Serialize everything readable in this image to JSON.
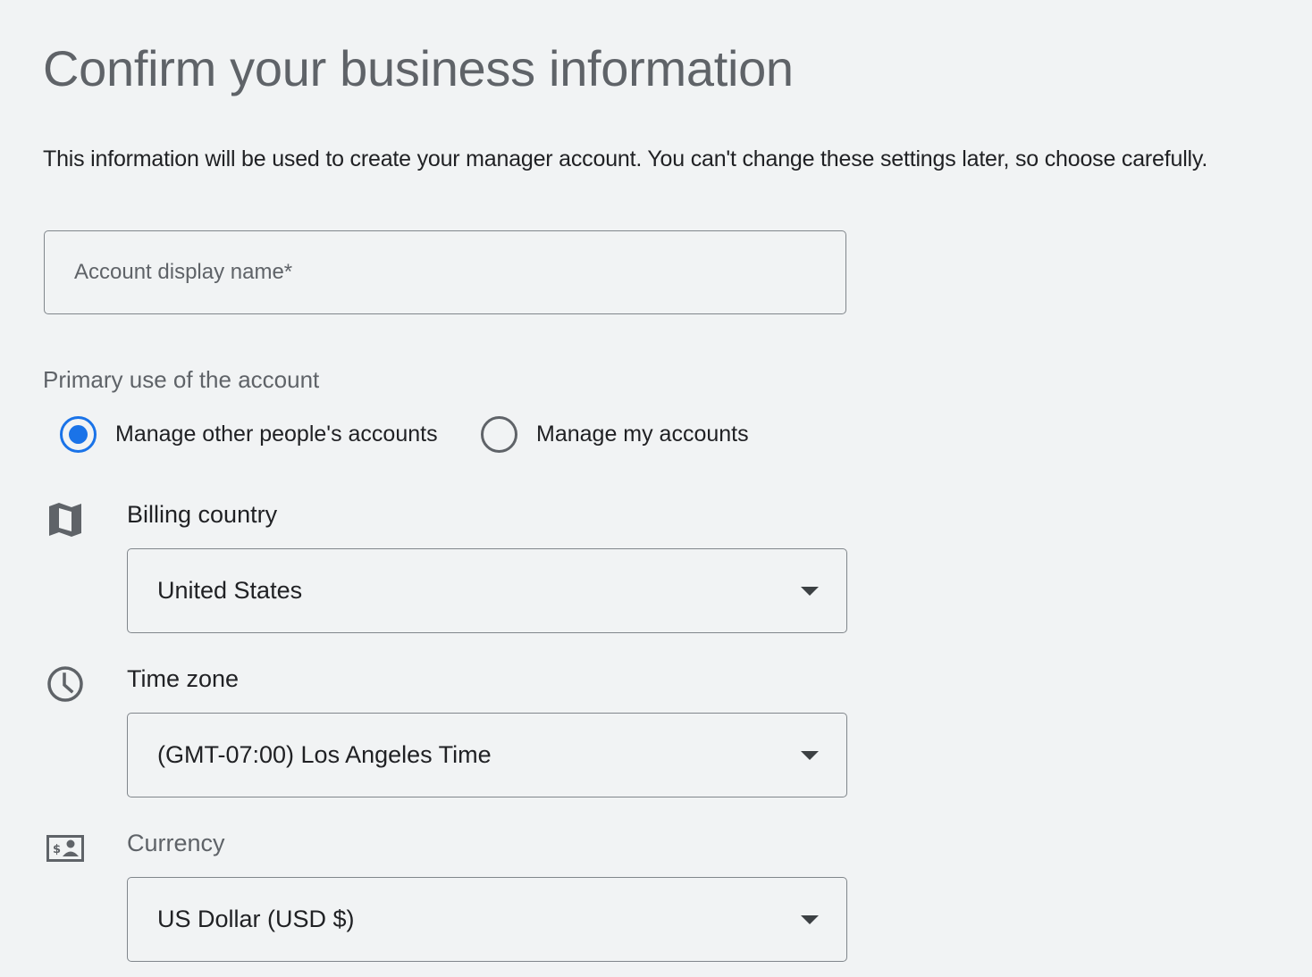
{
  "page": {
    "title": "Confirm your business information",
    "subtitle": "This information will be used to create your manager account. You can't change these settings later, so choose carefully."
  },
  "account_name": {
    "placeholder": "Account display name*",
    "value": ""
  },
  "primary_use": {
    "label": "Primary use of the account",
    "options": [
      {
        "label": "Manage other people's accounts",
        "selected": true
      },
      {
        "label": "Manage my accounts",
        "selected": false
      }
    ]
  },
  "billing_country": {
    "label": "Billing country",
    "icon": "map-icon",
    "value": "United States"
  },
  "time_zone": {
    "label": "Time zone",
    "icon": "clock-icon",
    "value": "(GMT-07:00) Los Angeles Time"
  },
  "currency": {
    "label": "Currency",
    "icon": "currency-bill-icon",
    "value": "US Dollar (USD $)"
  },
  "colors": {
    "accent": "#1a73e8",
    "background": "#f1f3f4",
    "border": "#80868b",
    "text": "#202124",
    "muted_text": "#5f6368"
  }
}
